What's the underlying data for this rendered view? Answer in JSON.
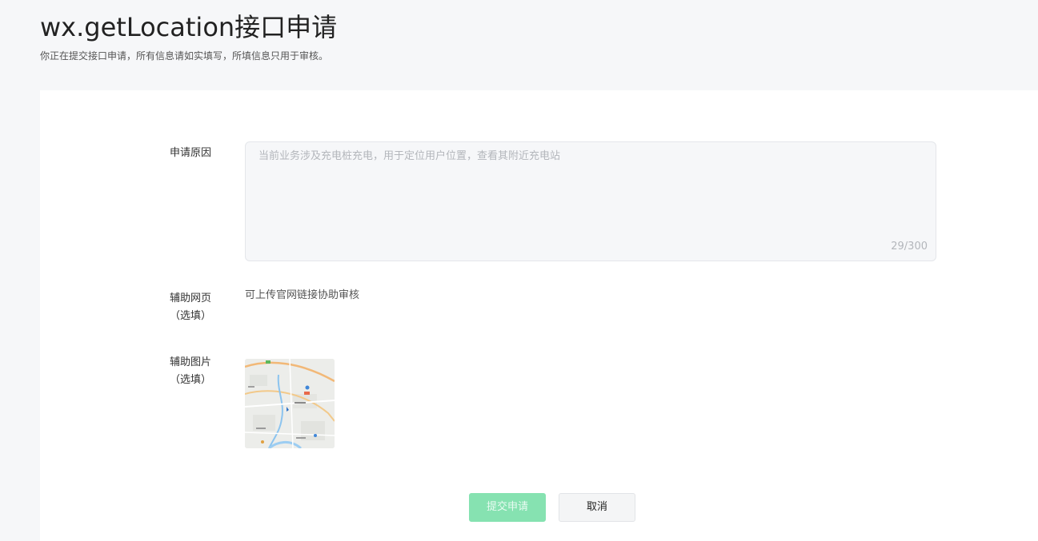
{
  "header": {
    "title": "wx.getLocation接口申请",
    "subtitle": "你正在提交接口申请，所有信息请如实填写，所填信息只用于审核。"
  },
  "form": {
    "reason": {
      "label": "申请原因",
      "value": "当前业务涉及充电桩充电，用于定位用户位置，查看其附近充电站",
      "count": "29/300"
    },
    "webpage": {
      "label_line1": "辅助网页",
      "label_line2": "（选填）",
      "hint": "可上传官网链接协助审核"
    },
    "image": {
      "label_line1": "辅助图片",
      "label_line2": "（选填）",
      "thumbnail": "map-thumbnail"
    }
  },
  "actions": {
    "submit_label": "提交申请",
    "cancel_label": "取消"
  },
  "colors": {
    "page_bg": "#f6f7f9",
    "primary_disabled": "#86e2b1",
    "panel_bg": "#ffffff"
  }
}
